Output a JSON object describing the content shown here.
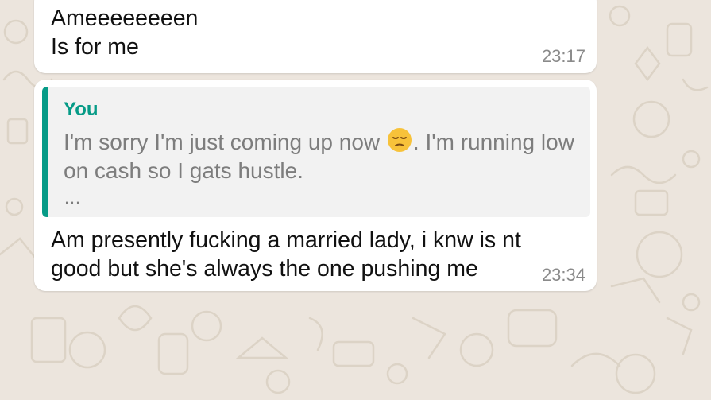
{
  "messages": [
    {
      "text": "Ameeeeeeeen\nIs for me",
      "time": "23:17"
    },
    {
      "quote": {
        "author": "You",
        "text_before_emoji": "I'm sorry I'm just coming up now ",
        "emoji": "pensive-face-emoji",
        "text_after_emoji": ". I'm running low on cash so I gats hustle.",
        "ellipsis": "…"
      },
      "text": "Am presently fucking a married lady, i knw is nt good but she's always the one pushing me",
      "time": "23:34"
    }
  ],
  "colors": {
    "background": "#ece5dd",
    "bubble": "#ffffff",
    "quote_accent": "#069b87",
    "time": "#8a8a8a"
  }
}
